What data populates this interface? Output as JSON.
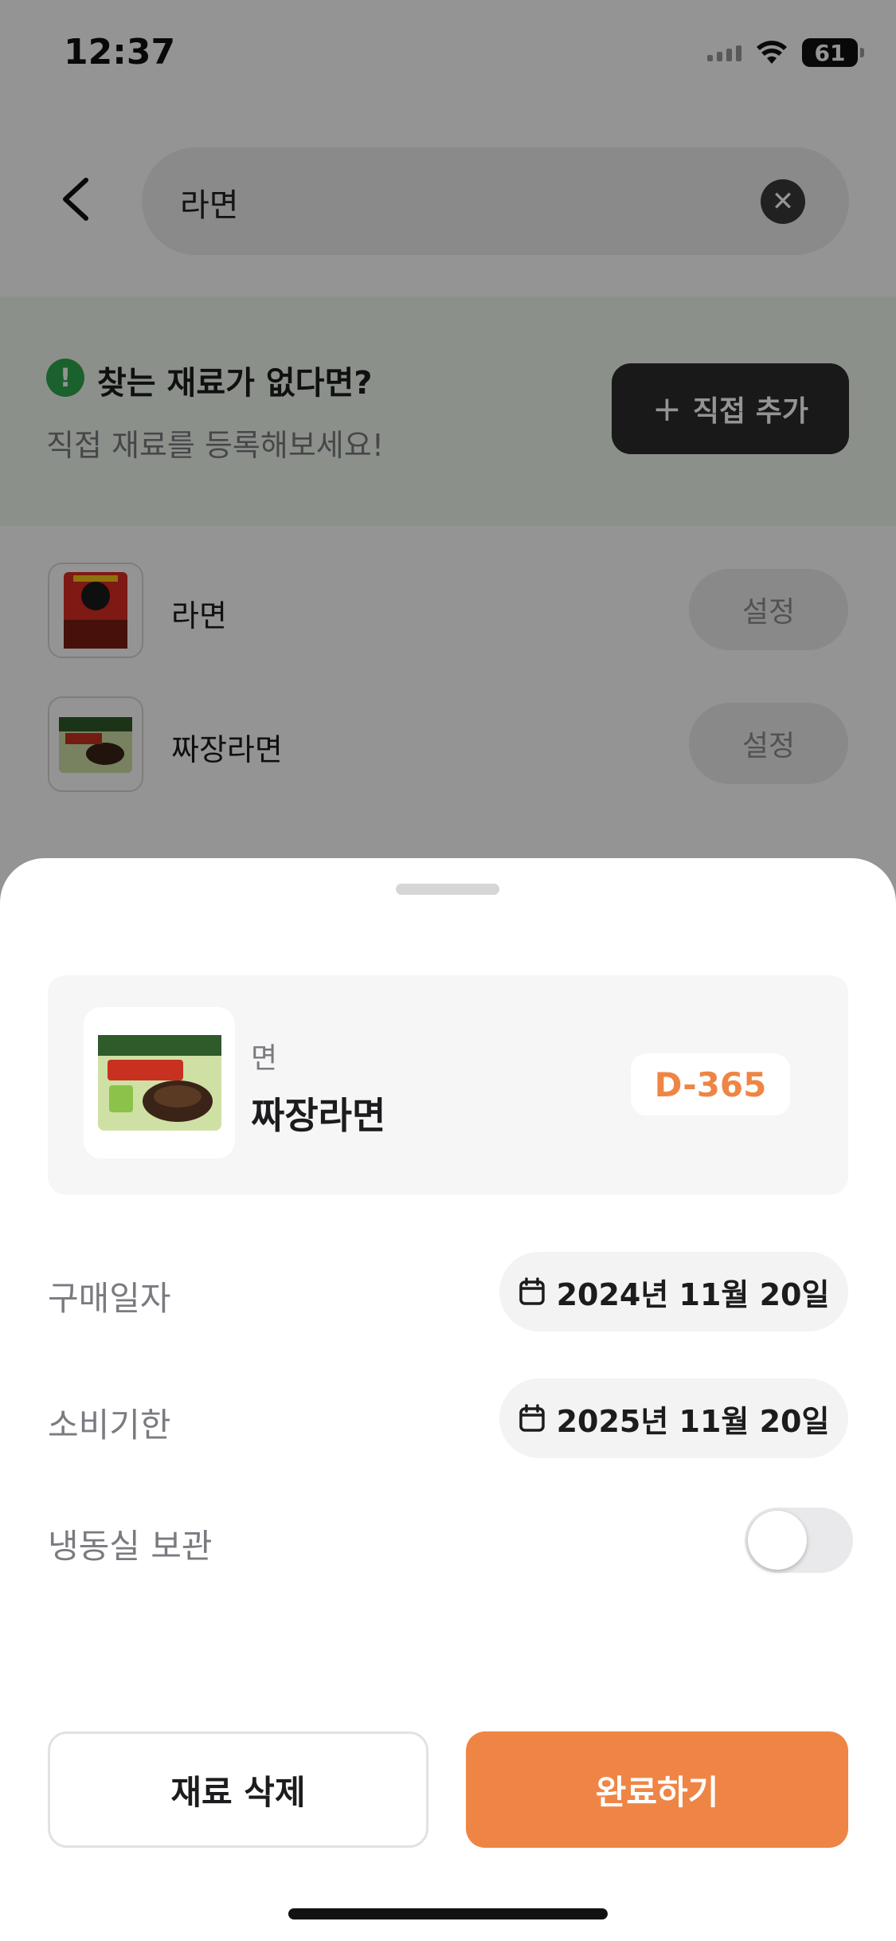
{
  "status_bar": {
    "time": "12:37",
    "battery": "61"
  },
  "search": {
    "value": "라면"
  },
  "notice": {
    "title": "찾는 재료가 없다면?",
    "subtitle": "직접 재료를 등록해보세요!",
    "add_button": "직접 추가"
  },
  "results": [
    {
      "name": "라면",
      "action": "설정"
    },
    {
      "name": "짜장라면",
      "action": "설정"
    }
  ],
  "sheet": {
    "item": {
      "category": "면",
      "name": "짜장라면",
      "dday": "D-365"
    },
    "purchase_date": {
      "label": "구매일자",
      "value": "2024년 11월 20일"
    },
    "expiry_date": {
      "label": "소비기한",
      "value": "2025년 11월 20일"
    },
    "freezer": {
      "label": "냉동실 보관",
      "enabled": false
    },
    "delete_button": "재료 삭제",
    "done_button": "완료하기"
  },
  "colors": {
    "accent": "#ef8545",
    "dark_button": "#2b2b2d",
    "notice_bg": "#f2f8ee",
    "notice_icon": "#2fa84f"
  }
}
